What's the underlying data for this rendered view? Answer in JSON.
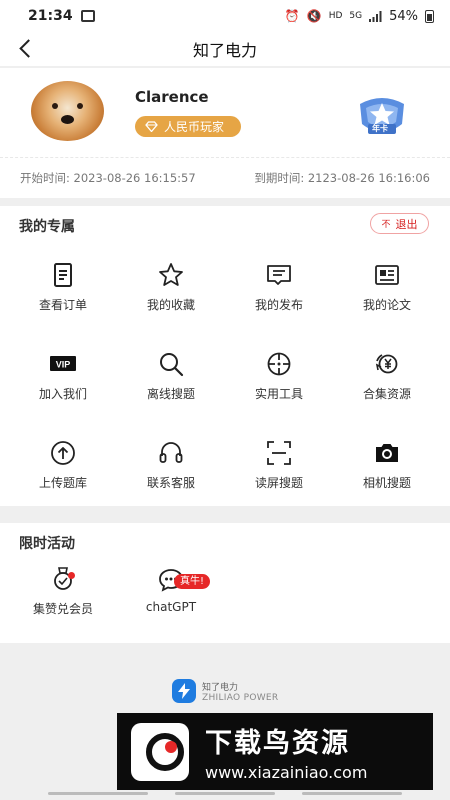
{
  "status_bar": {
    "time": "21:34",
    "battery": "54%",
    "network": "5G"
  },
  "nav": {
    "title": "知了电力"
  },
  "profile": {
    "name": "Clarence",
    "badge": "人民币玩家",
    "card_label": "年卡",
    "start_label": "开始时间:",
    "start_time": "2023-08-26 16:15:57",
    "end_label": "到期时间:",
    "end_time": "2123-08-26 16:16:06"
  },
  "exclusive": {
    "title": "我的专属",
    "logout": "退出",
    "items": [
      {
        "label": "查看订单",
        "icon": "order-icon"
      },
      {
        "label": "我的收藏",
        "icon": "star-icon"
      },
      {
        "label": "我的发布",
        "icon": "message-icon"
      },
      {
        "label": "我的论文",
        "icon": "newspaper-icon"
      },
      {
        "label": "加入我们",
        "icon": "vip-icon"
      },
      {
        "label": "离线搜题",
        "icon": "search-icon"
      },
      {
        "label": "实用工具",
        "icon": "crosshair-icon"
      },
      {
        "label": "合集资源",
        "icon": "yuan-refresh-icon"
      },
      {
        "label": "上传题库",
        "icon": "upload-icon"
      },
      {
        "label": "联系客服",
        "icon": "headset-icon"
      },
      {
        "label": "读屏搜题",
        "icon": "scan-icon"
      },
      {
        "label": "相机搜题",
        "icon": "camera-icon"
      }
    ]
  },
  "activities": {
    "title": "限时活动",
    "items": [
      {
        "label": "集赞兑会员",
        "icon": "medal-icon"
      },
      {
        "label": "chatGPT",
        "icon": "chat-icon",
        "tag": "真牛!"
      }
    ]
  },
  "footer": {
    "brand_cn": "知了电力",
    "brand_en": "ZHILIAO POWER"
  },
  "watermark": {
    "title": "下载鸟资源",
    "url": "www.xiazainiao.com"
  },
  "colors": {
    "badge": "#e6a545",
    "accent_red": "#e62828",
    "brand_blue": "#1f7ce0"
  }
}
